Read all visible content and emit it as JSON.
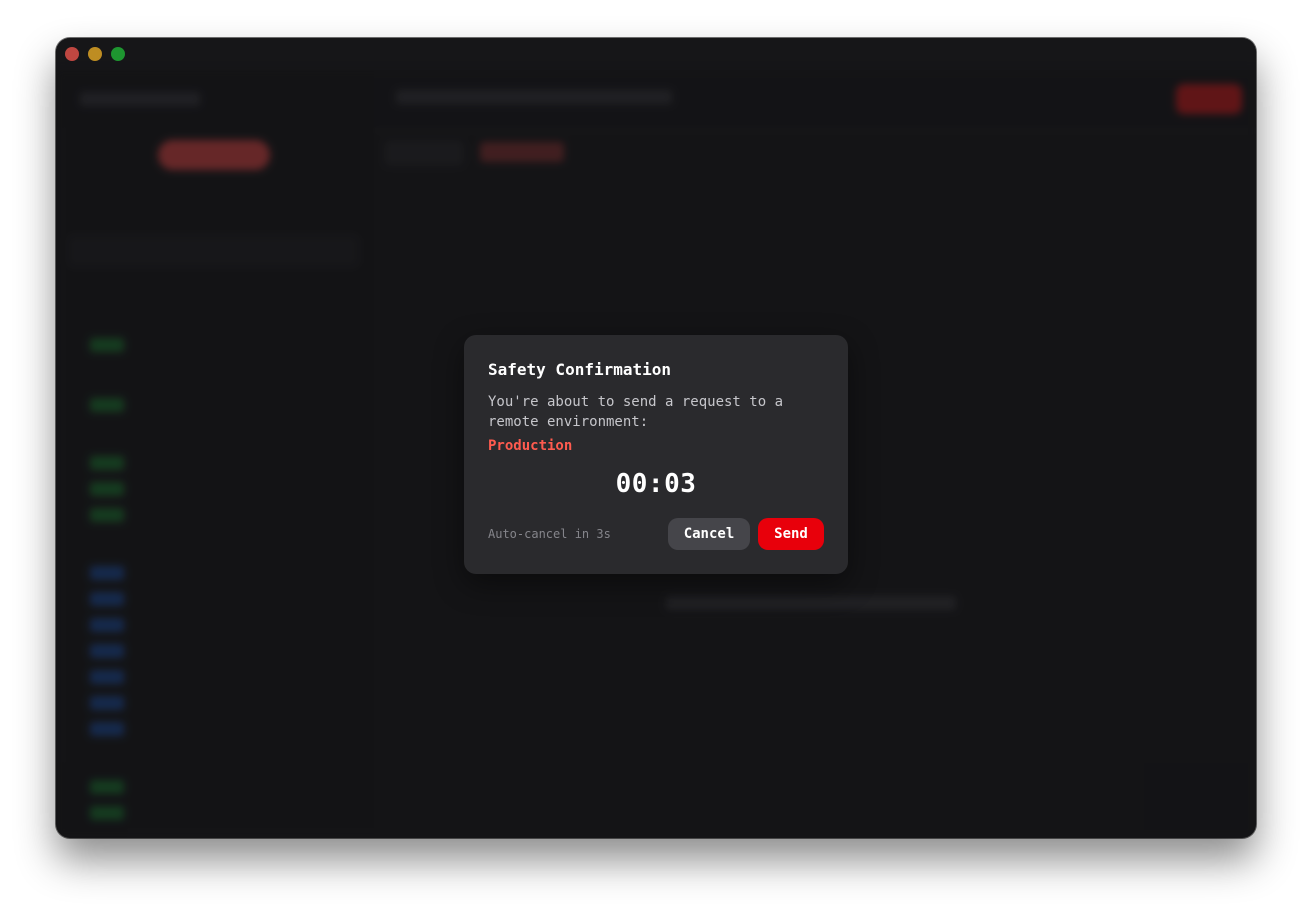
{
  "dialog": {
    "title": "Safety Confirmation",
    "message": "You're about to send a request to a remote environment:",
    "environment": "Production",
    "countdown": "00:03",
    "auto_cancel": "Auto-cancel in 3s",
    "cancel_label": "Cancel",
    "send_label": "Send"
  },
  "colors": {
    "accent_send": "#e8000b",
    "environment_text": "#ff5b4f",
    "dialog_bg": "#2a2a2d",
    "window_bg": "#1c1c1f"
  }
}
